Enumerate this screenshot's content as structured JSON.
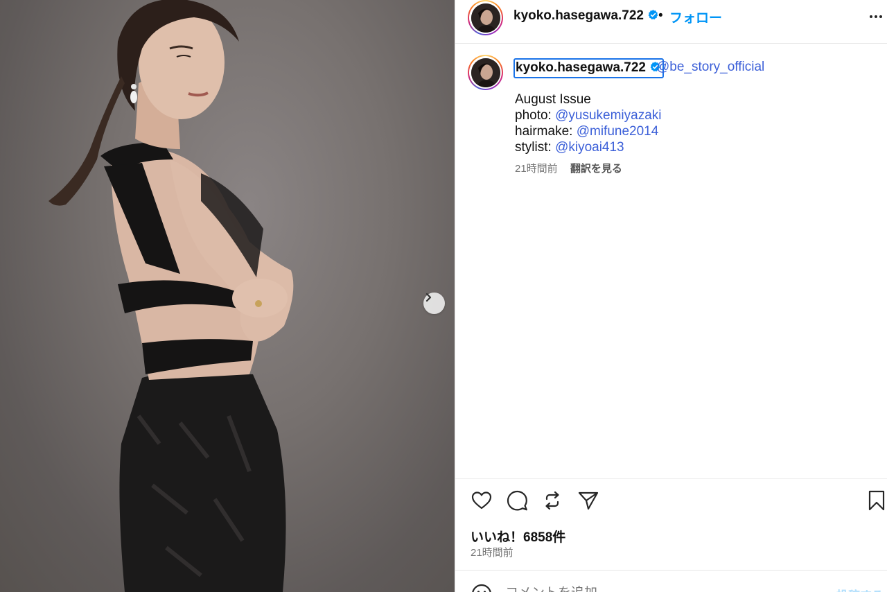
{
  "header": {
    "username": "kyoko.hasegawa.722",
    "separator": "•",
    "follow_label": "フォロー"
  },
  "caption": {
    "username": "kyoko.hasegawa.722",
    "mention": "@be_story_official",
    "lines": [
      {
        "label": "August Issue",
        "mention": ""
      },
      {
        "label": "photo: ",
        "mention": "@yusukemiyazaki"
      },
      {
        "label": "hairmake: ",
        "mention": "@mifune2014"
      },
      {
        "label": "stylist: ",
        "mention": "@kiyoai413"
      }
    ],
    "time": "21時間前",
    "translate_label": "翻訳を見る"
  },
  "footer": {
    "likes": "いいね！6858件",
    "time": "21時間前"
  },
  "comment": {
    "placeholder": "コメントを追加...",
    "post_label": "投稿する"
  },
  "icons": {
    "verified": "verified-badge-icon",
    "more": "more-options-icon",
    "like": "heart-icon",
    "comment": "comment-bubble-icon",
    "repost": "repost-icon",
    "share": "send-icon",
    "save": "bookmark-icon",
    "emoji": "emoji-icon",
    "next": "chevron-right-icon"
  },
  "colors": {
    "accent": "#0095f6",
    "mention": "#3b5fd8",
    "secondary_text": "#737373",
    "verified": "#0095f6"
  }
}
